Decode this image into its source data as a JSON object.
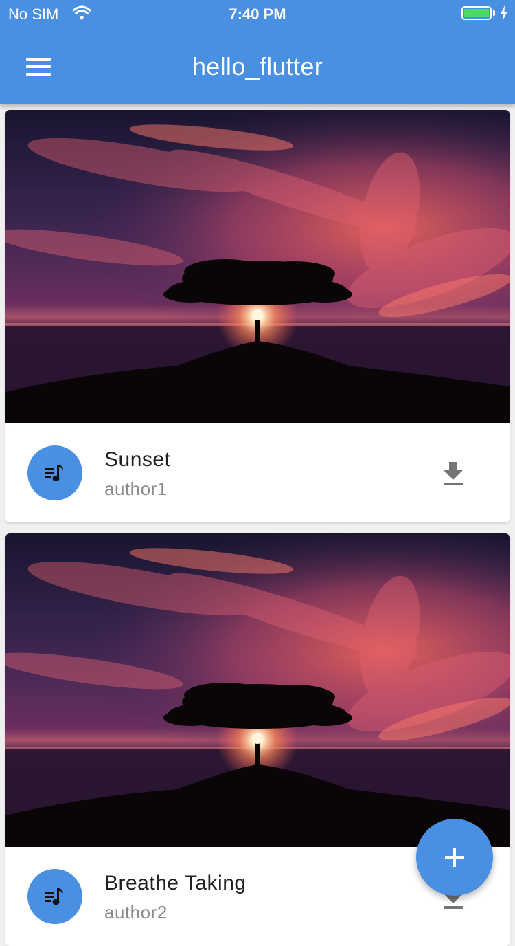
{
  "status_bar": {
    "carrier": "No SIM",
    "time": "7:40 PM"
  },
  "app_bar": {
    "title": "hello_flutter",
    "menu_icon": "hamburger-menu-icon"
  },
  "cards": [
    {
      "title": "Sunset",
      "author": "author1",
      "image": "sunset-tree-photo",
      "avatar_icon": "playlist-music-icon",
      "action_icon": "download-icon"
    },
    {
      "title": "Breathe Taking",
      "author": "author2",
      "image": "sunset-tree-photo",
      "avatar_icon": "playlist-music-icon",
      "action_icon": "download-icon"
    }
  ],
  "fab": {
    "icon": "add-icon"
  },
  "colors": {
    "primary": "#4a90e2",
    "background": "#f0f0f0",
    "battery": "#4cd964"
  }
}
